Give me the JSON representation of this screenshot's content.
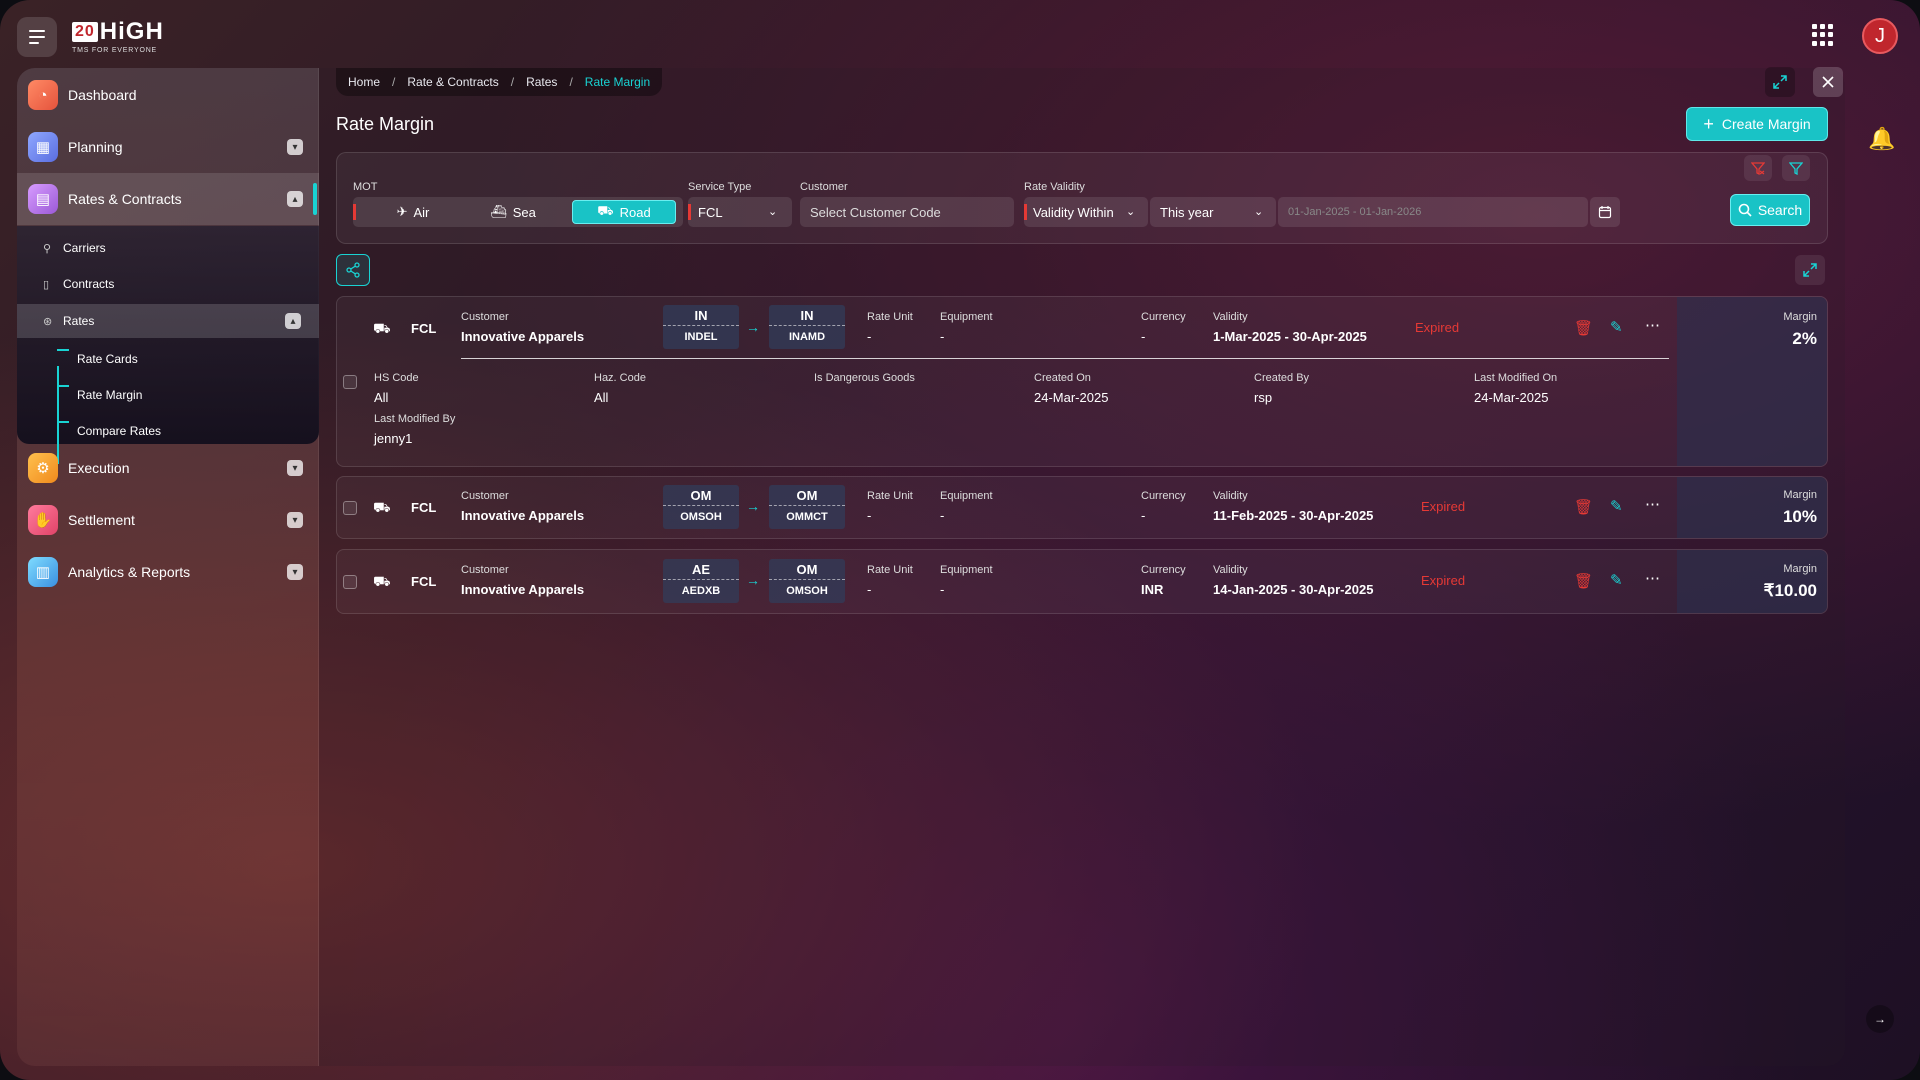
{
  "app": {
    "logo_number": "20",
    "logo_text": "HiGH",
    "logo_tagline": "TMS FOR EVERYONE",
    "avatar_initial": "J",
    "accent_color": "#19c3c6",
    "danger_color": "#e53935"
  },
  "sidebar": {
    "items": [
      {
        "label": "Dashboard",
        "icon": "speedometer-icon"
      },
      {
        "label": "Planning",
        "icon": "calendar-icon"
      },
      {
        "label": "Rates & Contracts",
        "icon": "document-icon"
      },
      {
        "label": "Execution",
        "icon": "gear-icon"
      },
      {
        "label": "Settlement",
        "icon": "handshake-icon"
      },
      {
        "label": "Analytics & Reports",
        "icon": "report-icon"
      }
    ],
    "sub_items": [
      {
        "label": "Carriers",
        "icon": "carrier-icon"
      },
      {
        "label": "Contracts",
        "icon": "contract-icon"
      },
      {
        "label": "Rates",
        "icon": "rates-icon"
      }
    ],
    "rates_children": [
      "Rate Cards",
      "Rate Margin",
      "Compare Rates"
    ]
  },
  "breadcrumb": [
    "Home",
    "Rate & Contracts",
    "Rates",
    "Rate Margin"
  ],
  "page": {
    "title": "Rate Margin",
    "create_button": "Create Margin"
  },
  "filters": {
    "mot_label": "MOT",
    "mot_options": [
      "Air",
      "Sea",
      "Road"
    ],
    "mot_selected": "Road",
    "service_type_label": "Service Type",
    "service_type_value": "FCL",
    "customer_label": "Customer",
    "customer_placeholder": "Select Customer Code",
    "rate_validity_label": "Rate Validity",
    "validity_mode": "Validity Within",
    "validity_period": "This year",
    "date_range_placeholder": "01-Jan-2025 - 01-Jan-2026",
    "search_button": "Search"
  },
  "records": [
    {
      "service": "FCL",
      "customer_label": "Customer",
      "customer": "Innovative Apparels",
      "origin_country": "IN",
      "origin_port": "INDEL",
      "dest_country": "IN",
      "dest_port": "INAMD",
      "rate_unit_label": "Rate Unit",
      "rate_unit": "-",
      "equipment_label": "Equipment",
      "equipment": "-",
      "currency_label": "Currency",
      "currency": "-",
      "validity_label": "Validity",
      "validity": "1-Mar-2025 - 30-Apr-2025",
      "status": "Expired",
      "margin_label": "Margin",
      "margin": "2%",
      "details": {
        "hs_code_label": "HS Code",
        "hs_code": "All",
        "haz_code_label": "Haz. Code",
        "haz_code": "All",
        "dangerous_label": "Is Dangerous Goods",
        "created_on_label": "Created On",
        "created_on": "24-Mar-2025",
        "created_by_label": "Created By",
        "created_by": "rsp",
        "modified_on_label": "Last Modified On",
        "modified_on": "24-Mar-2025",
        "modified_by_label": "Last Modified By",
        "modified_by": "jenny1"
      }
    },
    {
      "service": "FCL",
      "customer_label": "Customer",
      "customer": "Innovative Apparels",
      "origin_country": "OM",
      "origin_port": "OMSOH",
      "dest_country": "OM",
      "dest_port": "OMMCT",
      "rate_unit_label": "Rate Unit",
      "rate_unit": "-",
      "equipment_label": "Equipment",
      "equipment": "-",
      "currency_label": "Currency",
      "currency": "-",
      "validity_label": "Validity",
      "validity": "11-Feb-2025 - 30-Apr-2025",
      "status": "Expired",
      "margin_label": "Margin",
      "margin": "10%"
    },
    {
      "service": "FCL",
      "customer_label": "Customer",
      "customer": "Innovative Apparels",
      "origin_country": "AE",
      "origin_port": "AEDXB",
      "dest_country": "OM",
      "dest_port": "OMSOH",
      "rate_unit_label": "Rate Unit",
      "rate_unit": "-",
      "equipment_label": "Equipment",
      "equipment": "-",
      "currency_label": "Currency",
      "currency": "INR",
      "validity_label": "Validity",
      "validity": "14-Jan-2025 - 30-Apr-2025",
      "status": "Expired",
      "margin_label": "Margin",
      "margin": "₹10.00"
    }
  ]
}
